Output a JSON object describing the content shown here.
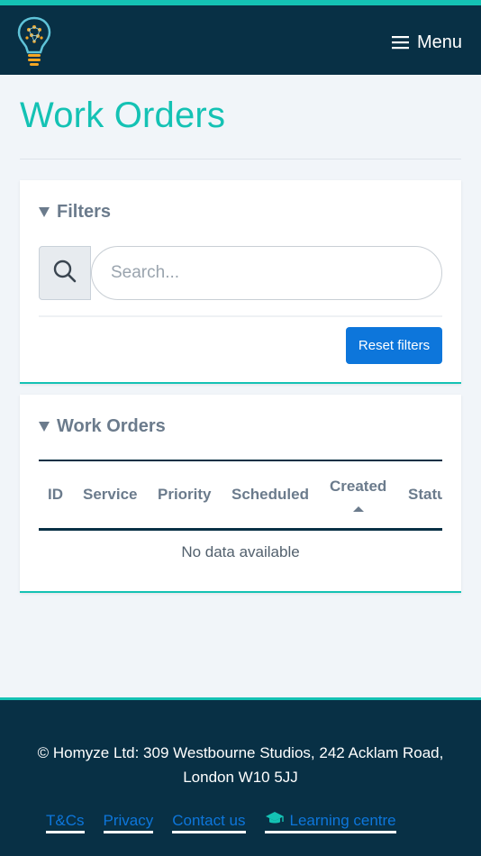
{
  "header": {
    "menu_label": "Menu"
  },
  "page": {
    "title": "Work Orders"
  },
  "filters": {
    "heading": "Filters",
    "search_placeholder": "Search...",
    "reset_label": "Reset filters"
  },
  "orders": {
    "heading": "Work Orders",
    "columns": [
      "ID",
      "Service",
      "Priority",
      "Scheduled",
      "Created",
      "Status"
    ],
    "visible_status_fragment": "Statu",
    "empty_text": "No data available"
  },
  "footer": {
    "address_line1": "© Homyze Ltd: 309 Westbourne Studios, 242 Acklam Road,",
    "address_line2": "London W10 5JJ",
    "links": [
      "T&Cs",
      "Privacy",
      "Contact us",
      "Learning centre"
    ]
  },
  "colors": {
    "accent_teal": "#14c2b4",
    "navy": "#083045",
    "button_blue": "#0d76db"
  },
  "icons": {
    "logo": "lightbulb-brain-logo",
    "menu": "hamburger-icon",
    "search": "search-icon",
    "learning": "graduation-cap-icon"
  }
}
